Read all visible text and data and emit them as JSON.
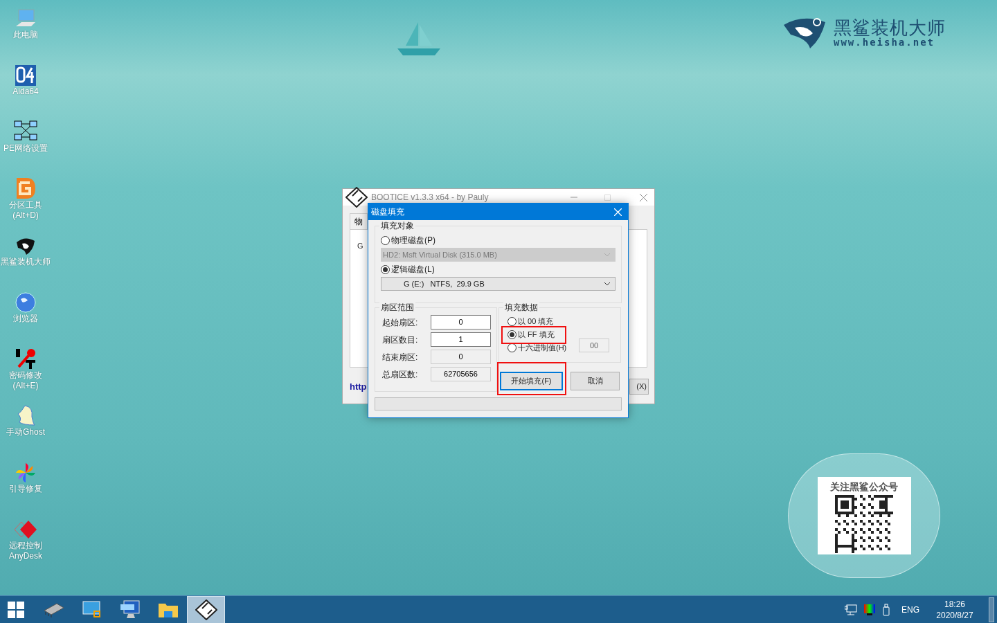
{
  "desktop_icons": [
    {
      "label": "此电脑"
    },
    {
      "label": "Aida64"
    },
    {
      "label": "PE网络设置"
    },
    {
      "label": "分区工具\n(Alt+D)"
    },
    {
      "label": "黑鲨装机大师"
    },
    {
      "label": "浏览器"
    },
    {
      "label": "密码修改\n(Alt+E)"
    },
    {
      "label": "手动Ghost"
    },
    {
      "label": "引导修复"
    },
    {
      "label": "远程控制\nAnyDesk"
    }
  ],
  "logo": {
    "name": "黑鲨装机大师",
    "url": "www.heisha.net"
  },
  "qr_panel": {
    "title": "关注黑鲨公众号"
  },
  "background_window": {
    "title": "BOOTICE v1.3.3 x64 - by Pauly",
    "tab": "物",
    "group": "G",
    "link": "http",
    "button": "(X)"
  },
  "dialog": {
    "title": "磁盘填充",
    "fill_target": {
      "legend": "填充对象",
      "options": [
        {
          "label": "物理磁盘(P)",
          "selected": false,
          "select_value": "HD2: Msft Virtual Disk (315.0 MB)"
        },
        {
          "label": "逻辑磁盘(L)",
          "selected": true,
          "select_value": "G (E:)   NTFS,  29.9 GB"
        }
      ]
    },
    "sector_range": {
      "legend": "扇区范围",
      "fields": [
        {
          "label": "起始扇区:",
          "value": "0",
          "readonly": false
        },
        {
          "label": "扇区数目:",
          "value": "1",
          "readonly": false
        },
        {
          "label": "结束扇区:",
          "value": "0",
          "readonly": true
        },
        {
          "label": "总扇区数:",
          "value": "62705656",
          "readonly": true
        }
      ]
    },
    "fill_data": {
      "legend": "填充数据",
      "options": [
        {
          "label": "以 00 填充",
          "selected": false
        },
        {
          "label": "以 FF 填充",
          "selected": true
        },
        {
          "label": "十六进制值(H)",
          "selected": false
        }
      ],
      "hex_value": "00"
    },
    "buttons": [
      {
        "label": "开始填充(F)",
        "focused": true
      },
      {
        "label": "取消",
        "focused": false
      }
    ]
  },
  "taskbar": {
    "apps": [
      {
        "active": false
      },
      {
        "active": false
      },
      {
        "active": false
      },
      {
        "active": false
      },
      {
        "active": true
      }
    ],
    "language": "ENG",
    "time": "18:26",
    "date": "2020/8/27"
  }
}
